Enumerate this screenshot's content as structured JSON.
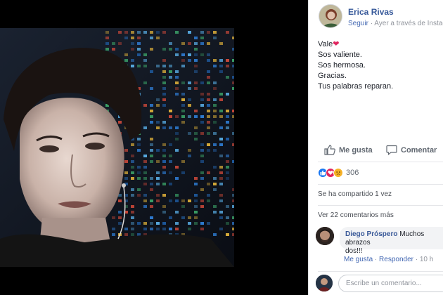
{
  "author": {
    "name": "Erica Rivas",
    "follow": "Seguir",
    "separator": "·",
    "time_source": "Ayer a través de Instagram"
  },
  "post": {
    "lines": [
      "Vale",
      "Sos valiente.",
      "Sos hermosa.",
      "Gracias.",
      "Tus palabras reparan."
    ],
    "heart": "❤"
  },
  "actions": {
    "like": "Me gusta",
    "comment": "Comentar"
  },
  "reactions": {
    "count": "306",
    "types": [
      "like-icon",
      "love-icon",
      "sad-icon"
    ]
  },
  "shares": "Se ha compartido 1 vez",
  "view_comments": "Ver 22 comentarios más",
  "comment": {
    "author": "Diego Próspero",
    "text_line1": "Muchos abrazos",
    "text_line2": "dos!!!",
    "like": "Me gusta",
    "separator": "·",
    "reply": "Responder",
    "time": "10 h"
  },
  "write": {
    "placeholder": "Escribe un comentario..."
  },
  "colors": {
    "link": "#365899",
    "like_blue": "#1877f2",
    "love_red": "#e0245e",
    "sad_yellow": "#f7b125"
  }
}
